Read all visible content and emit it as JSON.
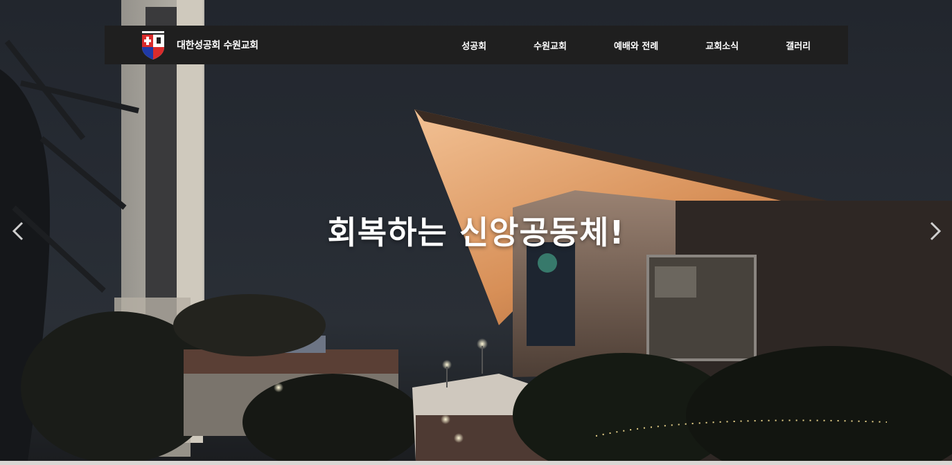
{
  "header": {
    "brand_name": "대한성공회 수원교회",
    "logo_icon": "church-shield-logo",
    "menu": [
      "성공회",
      "수원교회",
      "예배와 전례",
      "교회소식",
      "갤러리"
    ]
  },
  "hero": {
    "title": "회복하는 신앙공동체!",
    "prev_icon": "chevron-left-icon",
    "next_icon": "chevron-right-icon"
  },
  "colors": {
    "navbar_bg": "#1f1f1f",
    "text": "#ffffff",
    "roof_wood": "#e0a06a"
  }
}
